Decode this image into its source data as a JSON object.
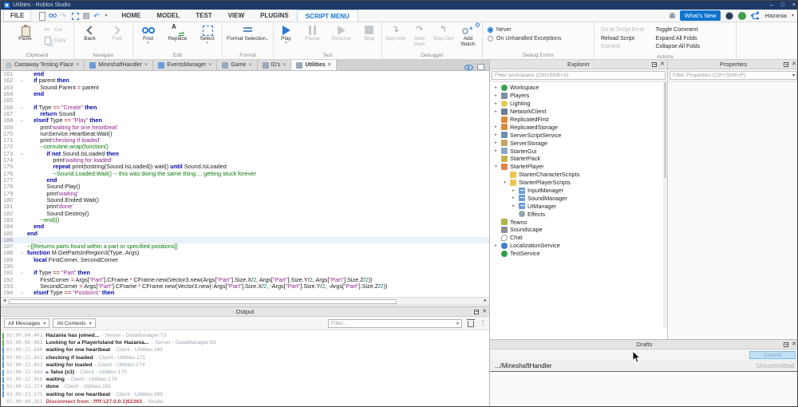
{
  "colors": {
    "accent": "#1073cf",
    "titlebar": "#1d3a68",
    "keyword": "#0007a8",
    "string": "#90278e",
    "comment": "#067a06",
    "operator": "#a31515",
    "number": "#067a7a",
    "error_text": "#b03a48",
    "server_bar": "#63b75a",
    "client_bar": "#5b9bd5"
  },
  "titlebar": {
    "title": "Utilities - Roblox Studio"
  },
  "menubar": {
    "file": "FILE",
    "menus": [
      "HOME",
      "MODEL",
      "TEST",
      "VIEW",
      "PLUGINS",
      "SCRIPT MENU"
    ],
    "active_menu": "SCRIPT MENU",
    "whats_new": "What's New",
    "username": "Hazania"
  },
  "ribbon": {
    "clipboard": {
      "label": "Clipboard",
      "paste": "Paste",
      "cut": "Cut",
      "copy": "Copy"
    },
    "navigate": {
      "label": "Navigate",
      "back": "Back",
      "fwd": "Fwd"
    },
    "edit": {
      "label": "Edit",
      "find": "Find",
      "replace": "Replace",
      "select": "Select"
    },
    "format": {
      "label": "Format",
      "format_selection": "Format Selection.."
    },
    "test": {
      "label": "Test",
      "play": "Play",
      "pause": "Pause",
      "resume": "Resume",
      "stop": "Stop"
    },
    "debugger": {
      "label": "Debugger",
      "step_into": "Step Into",
      "step_over": "Step Over",
      "step_out": "Step Out",
      "add_watch": "Add Watch"
    },
    "debug_errors": {
      "label": "Debug Errors",
      "never": "Never",
      "on_unhandled": "On Unhandled Exceptions"
    },
    "actions": {
      "label": "Actions",
      "items": [
        {
          "label": "Go to Script Error",
          "disabled": true
        },
        {
          "label": "Reload Script",
          "disabled": false
        },
        {
          "label": "Commit",
          "disabled": true
        },
        {
          "label": "Toggle Comment",
          "disabled": false
        },
        {
          "label": "Expand All Folds",
          "disabled": false
        },
        {
          "label": "Collapse All Folds",
          "disabled": false
        }
      ]
    }
  },
  "tabs": [
    {
      "label": "Castaway Testing Place",
      "icon": "place",
      "active": false
    },
    {
      "label": "MineshaftHandler",
      "icon": "script-blue",
      "active": false
    },
    {
      "label": "EventsManager",
      "icon": "script-blue",
      "active": false
    },
    {
      "label": "Game",
      "icon": "script-gray",
      "active": false
    },
    {
      "label": "ID's",
      "icon": "script-gray",
      "active": false
    },
    {
      "label": "Utilities",
      "icon": "script-gray",
      "active": true
    }
  ],
  "editor": {
    "current_line": 186,
    "lines": [
      {
        "n": 161,
        "f": false,
        "t": [
          [
            "p",
            "    "
          ],
          [
            "k",
            "end"
          ]
        ]
      },
      {
        "n": 162,
        "f": true,
        "t": [
          [
            "p",
            "    "
          ],
          [
            "k",
            "if"
          ],
          [
            "p",
            " parent "
          ],
          [
            "k",
            "then"
          ]
        ]
      },
      {
        "n": 163,
        "f": false,
        "t": [
          [
            "p",
            "        Sound.Parent "
          ],
          [
            "o",
            "="
          ],
          [
            "p",
            " parent"
          ]
        ]
      },
      {
        "n": 164,
        "f": false,
        "t": [
          [
            "p",
            "    "
          ],
          [
            "k",
            "end"
          ]
        ]
      },
      {
        "n": 165,
        "f": false,
        "t": []
      },
      {
        "n": 166,
        "f": true,
        "t": [
          [
            "p",
            "    "
          ],
          [
            "k",
            "if"
          ],
          [
            "p",
            " Type "
          ],
          [
            "o",
            "=="
          ],
          [
            "p",
            " "
          ],
          [
            "s",
            "\"Create\""
          ],
          [
            "p",
            " "
          ],
          [
            "k",
            "then"
          ]
        ]
      },
      {
        "n": 167,
        "f": false,
        "t": [
          [
            "p",
            "        "
          ],
          [
            "k",
            "return"
          ],
          [
            "p",
            " Sound"
          ]
        ]
      },
      {
        "n": 168,
        "f": true,
        "t": [
          [
            "p",
            "    "
          ],
          [
            "k",
            "elseif"
          ],
          [
            "p",
            " Type "
          ],
          [
            "o",
            "=="
          ],
          [
            "p",
            " "
          ],
          [
            "s",
            "\"Play\""
          ],
          [
            "p",
            " "
          ],
          [
            "k",
            "then"
          ]
        ]
      },
      {
        "n": 169,
        "f": false,
        "t": [
          [
            "p",
            "        print"
          ],
          [
            "s",
            "'waiting for one heartbeat'"
          ]
        ]
      },
      {
        "n": 170,
        "f": false,
        "t": [
          [
            "p",
            "        runService.Heartbeat:Wait()"
          ]
        ]
      },
      {
        "n": 171,
        "f": false,
        "t": [
          [
            "p",
            "        print"
          ],
          [
            "s",
            "'checking if loaded'"
          ]
        ]
      },
      {
        "n": 172,
        "f": false,
        "t": [
          [
            "p",
            "        "
          ],
          [
            "c",
            "--coroutine.wrap(function()"
          ]
        ]
      },
      {
        "n": 173,
        "f": true,
        "t": [
          [
            "p",
            "            "
          ],
          [
            "k",
            "if"
          ],
          [
            "p",
            " "
          ],
          [
            "k",
            "not"
          ],
          [
            "p",
            " Sound.IsLoaded "
          ],
          [
            "k",
            "then"
          ]
        ]
      },
      {
        "n": 174,
        "f": false,
        "t": [
          [
            "p",
            "                print"
          ],
          [
            "s",
            "'waiting for loaded'"
          ]
        ]
      },
      {
        "n": 175,
        "f": false,
        "t": [
          [
            "p",
            "                "
          ],
          [
            "k",
            "repeat"
          ],
          [
            "p",
            " print(tostring(Sound.IsLoaded)) wait() "
          ],
          [
            "k",
            "until"
          ],
          [
            "p",
            " Sound.IsLoaded"
          ]
        ]
      },
      {
        "n": 176,
        "f": false,
        "t": [
          [
            "p",
            "                "
          ],
          [
            "c",
            "--Sound.Loaded:Wait() -- this was doing the same thing.... getting stuck forever"
          ]
        ]
      },
      {
        "n": 177,
        "f": false,
        "t": [
          [
            "p",
            "            "
          ],
          [
            "k",
            "end"
          ]
        ]
      },
      {
        "n": 178,
        "f": false,
        "t": [
          [
            "p",
            "            Sound:Play()"
          ]
        ]
      },
      {
        "n": 179,
        "f": false,
        "t": [
          [
            "p",
            "            print"
          ],
          [
            "s",
            "'waiting'"
          ]
        ]
      },
      {
        "n": 180,
        "f": false,
        "t": [
          [
            "p",
            "            Sound.Ended:Wait()"
          ]
        ]
      },
      {
        "n": 181,
        "f": false,
        "t": [
          [
            "p",
            "            print"
          ],
          [
            "s",
            "'done'"
          ]
        ]
      },
      {
        "n": 182,
        "f": false,
        "t": [
          [
            "p",
            "            Sound:Destroy()"
          ]
        ]
      },
      {
        "n": 183,
        "f": false,
        "t": [
          [
            "p",
            "        "
          ],
          [
            "c",
            "--end)()"
          ]
        ]
      },
      {
        "n": 184,
        "f": false,
        "t": [
          [
            "p",
            "    "
          ],
          [
            "k",
            "end"
          ]
        ]
      },
      {
        "n": 185,
        "f": false,
        "t": [
          [
            "k",
            "end"
          ]
        ]
      },
      {
        "n": 186,
        "f": false,
        "t": []
      },
      {
        "n": 187,
        "f": false,
        "t": [
          [
            "c",
            "--[[Returns parts found within a part or specified positions]]"
          ]
        ]
      },
      {
        "n": 188,
        "f": true,
        "t": [
          [
            "k",
            "function"
          ],
          [
            "p",
            " M.GetPartsInRegion3(Type, Args)"
          ]
        ]
      },
      {
        "n": 189,
        "f": false,
        "t": [
          [
            "p",
            "    "
          ],
          [
            "k",
            "local"
          ],
          [
            "p",
            " FirstCorner, SecondCorner"
          ]
        ]
      },
      {
        "n": 190,
        "f": false,
        "t": []
      },
      {
        "n": 191,
        "f": true,
        "t": [
          [
            "p",
            "    "
          ],
          [
            "k",
            "if"
          ],
          [
            "p",
            " Type "
          ],
          [
            "o",
            "=="
          ],
          [
            "p",
            " "
          ],
          [
            "s",
            "\"Part\""
          ],
          [
            "p",
            " "
          ],
          [
            "k",
            "then"
          ]
        ]
      },
      {
        "n": 192,
        "f": false,
        "t": [
          [
            "p",
            "        FirstCorner "
          ],
          [
            "o",
            "="
          ],
          [
            "p",
            " Args["
          ],
          [
            "s",
            "\"Part\""
          ],
          [
            "p",
            "].CFrame "
          ],
          [
            "o",
            "*"
          ],
          [
            "p",
            " CFrame.new(Vector3.new(Args["
          ],
          [
            "s",
            "\"Part\""
          ],
          [
            "p",
            "].Size.X/"
          ],
          [
            "n",
            "2"
          ],
          [
            "p",
            ", Args["
          ],
          [
            "s",
            "\"Part\""
          ],
          [
            "p",
            "].Size.Y/"
          ],
          [
            "n",
            "2"
          ],
          [
            "p",
            ", Args["
          ],
          [
            "s",
            "\"Part\""
          ],
          [
            "p",
            "].Size.Z/"
          ],
          [
            "n",
            "2"
          ],
          [
            "p",
            "))"
          ]
        ]
      },
      {
        "n": 193,
        "f": false,
        "t": [
          [
            "p",
            "        SecondCorner "
          ],
          [
            "o",
            "="
          ],
          [
            "p",
            " Args["
          ],
          [
            "s",
            "\"Part\""
          ],
          [
            "p",
            "].CFrame "
          ],
          [
            "o",
            "*"
          ],
          [
            "p",
            " CFrame.new(Vector3.new(-Args["
          ],
          [
            "s",
            "\"Part\""
          ],
          [
            "p",
            "].Size.X/"
          ],
          [
            "n",
            "2"
          ],
          [
            "p",
            ", -Args["
          ],
          [
            "s",
            "\"Part\""
          ],
          [
            "p",
            "].Size.Y/"
          ],
          [
            "n",
            "2"
          ],
          [
            "p",
            ", -Args["
          ],
          [
            "s",
            "\"Part\""
          ],
          [
            "p",
            "].Size.Z/"
          ],
          [
            "n",
            "2"
          ],
          [
            "p",
            "))"
          ]
        ]
      },
      {
        "n": 194,
        "f": true,
        "t": [
          [
            "p",
            "    "
          ],
          [
            "k",
            "elseif"
          ],
          [
            "p",
            " Type "
          ],
          [
            "o",
            "=="
          ],
          [
            "p",
            " "
          ],
          [
            "s",
            "\"Positions\""
          ],
          [
            "p",
            " "
          ],
          [
            "k",
            "then"
          ]
        ]
      }
    ]
  },
  "explorer": {
    "title": "Explorer",
    "filter_placeholder": "Filter workspace (Ctrl+Shift+X)",
    "items": [
      {
        "label": "Workspace",
        "depth": 0,
        "arrow": "right",
        "icon": "workspace"
      },
      {
        "label": "Players",
        "depth": 0,
        "arrow": "right",
        "icon": "players"
      },
      {
        "label": "Lighting",
        "depth": 0,
        "arrow": "right",
        "icon": "lighting"
      },
      {
        "label": "NetworkClient",
        "depth": 0,
        "arrow": "right",
        "icon": "network"
      },
      {
        "label": "ReplicatedFirst",
        "depth": 0,
        "arrow": "",
        "icon": "repfirst"
      },
      {
        "label": "ReplicatedStorage",
        "depth": 0,
        "arrow": "right",
        "icon": "repstorage"
      },
      {
        "label": "ServerScriptService",
        "depth": 0,
        "arrow": "right",
        "icon": "serverscript"
      },
      {
        "label": "ServerStorage",
        "depth": 0,
        "arrow": "right",
        "icon": "serverstorage"
      },
      {
        "label": "StarterGui",
        "depth": 0,
        "arrow": "right",
        "icon": "startergui"
      },
      {
        "label": "StarterPack",
        "depth": 0,
        "arrow": "",
        "icon": "starterpack"
      },
      {
        "label": "StarterPlayer",
        "depth": 0,
        "arrow": "down",
        "icon": "starterplayer"
      },
      {
        "label": "StarterCharacterScripts",
        "depth": 1,
        "arrow": "",
        "icon": "folder"
      },
      {
        "label": "StarterPlayerScripts",
        "depth": 1,
        "arrow": "down",
        "icon": "folder"
      },
      {
        "label": "InputManager",
        "depth": 2,
        "arrow": "right",
        "icon": "localscript"
      },
      {
        "label": "SoundManager",
        "depth": 2,
        "arrow": "right",
        "icon": "localscript"
      },
      {
        "label": "UIManager",
        "depth": 2,
        "arrow": "right",
        "icon": "localscript"
      },
      {
        "label": "Effects",
        "depth": 2,
        "arrow": "",
        "icon": "effects"
      },
      {
        "label": "Teams",
        "depth": 0,
        "arrow": "",
        "icon": "teams"
      },
      {
        "label": "Soundscape",
        "depth": 0,
        "arrow": "",
        "icon": "soundscape"
      },
      {
        "label": "Chat",
        "depth": 0,
        "arrow": "",
        "icon": "chat"
      },
      {
        "label": "LocalizationService",
        "depth": 0,
        "arrow": "right",
        "icon": "localization"
      },
      {
        "label": "TestService",
        "depth": 0,
        "arrow": "",
        "icon": "testservice"
      }
    ]
  },
  "properties": {
    "title": "Properties",
    "filter_placeholder": "Filter Properties (Ctrl+Shift+P)"
  },
  "output": {
    "title": "Output",
    "messages_filter": "All Messages",
    "contexts_filter": "All Contexts",
    "filter_placeholder": "Filter...",
    "rows": [
      {
        "time": "02:00:04.401",
        "msg": "Hazania has joined...",
        "ctx": "- Server - DataManager:73",
        "bar": "server",
        "expandable": false,
        "error": false
      },
      {
        "time": "02:00:06.983",
        "msg": "Looking for a PlayerIsland for Hazania...",
        "ctx": "- Server - DataManager:63",
        "bar": "server",
        "expandable": false,
        "error": false
      },
      {
        "time": "02:00:22.840",
        "msg": "waiting for one heartbeat",
        "ctx": "- Client - Utilities:169",
        "bar": "client",
        "expandable": false,
        "error": false
      },
      {
        "time": "02:00:22.843",
        "msg": "checking if loaded",
        "ctx": "- Client - Utilities:171",
        "bar": "client",
        "expandable": false,
        "error": false
      },
      {
        "time": "02:00:22.843",
        "msg": "waiting for loaded",
        "ctx": "- Client - Utilities:174",
        "bar": "client",
        "expandable": false,
        "error": false
      },
      {
        "time": "02:00:22.844",
        "msg": "false (x3)",
        "ctx": "- Client - Utilities:175",
        "bar": "client",
        "expandable": true,
        "error": false
      },
      {
        "time": "02:00:22.958",
        "msg": "waiting",
        "ctx": "- Client - Utilities:179",
        "bar": "client",
        "expandable": false,
        "error": false
      },
      {
        "time": "02:00:23.174",
        "msg": "done",
        "ctx": "- Client - Utilities:181",
        "bar": "client",
        "expandable": false,
        "error": false
      },
      {
        "time": "02:00:23.175",
        "msg": "waiting for one heartbeat",
        "ctx": "- Client - Utilities:169",
        "bar": "client",
        "expandable": false,
        "error": false
      },
      {
        "time": "02:00:40.261",
        "msg": "Disconnect from ::ffff:127.0.0.1|62363",
        "ctx": "- Studio",
        "bar": "none",
        "expandable": false,
        "error": true
      }
    ]
  },
  "drafts": {
    "title": "Drafts",
    "commit_button": "Commit",
    "rows": [
      {
        "name": ".../MineshaftHandler",
        "status": "Uncommitted"
      }
    ]
  }
}
